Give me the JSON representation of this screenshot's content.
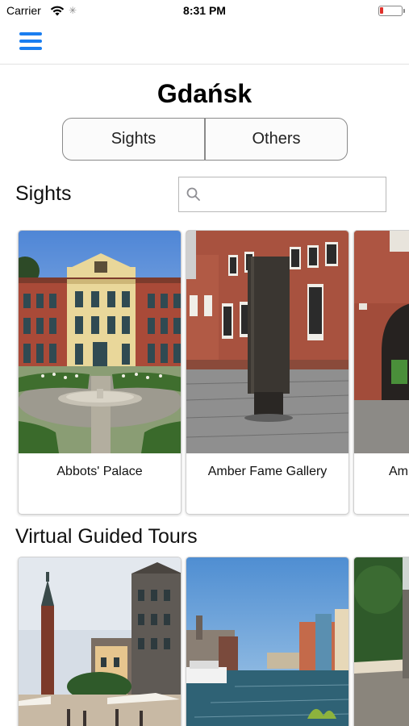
{
  "status_bar": {
    "carrier": "Carrier",
    "time": "8:31 PM",
    "battery_level": 0.15,
    "battery_color": "#e0302a"
  },
  "nav": {
    "menu_icon": "hamburger-menu-icon",
    "accent_color": "#1a7ef0"
  },
  "page": {
    "title": "Gdańsk"
  },
  "segmented_control": {
    "options": [
      "Sights",
      "Others"
    ]
  },
  "sights_section": {
    "title": "Sights",
    "search_placeholder": "",
    "search_value": "",
    "cards": [
      {
        "label": "Abbots' Palace"
      },
      {
        "label": "Amber Fame Gallery"
      },
      {
        "label": "Aml"
      }
    ]
  },
  "tours_section": {
    "title": "Virtual Guided Tours"
  }
}
